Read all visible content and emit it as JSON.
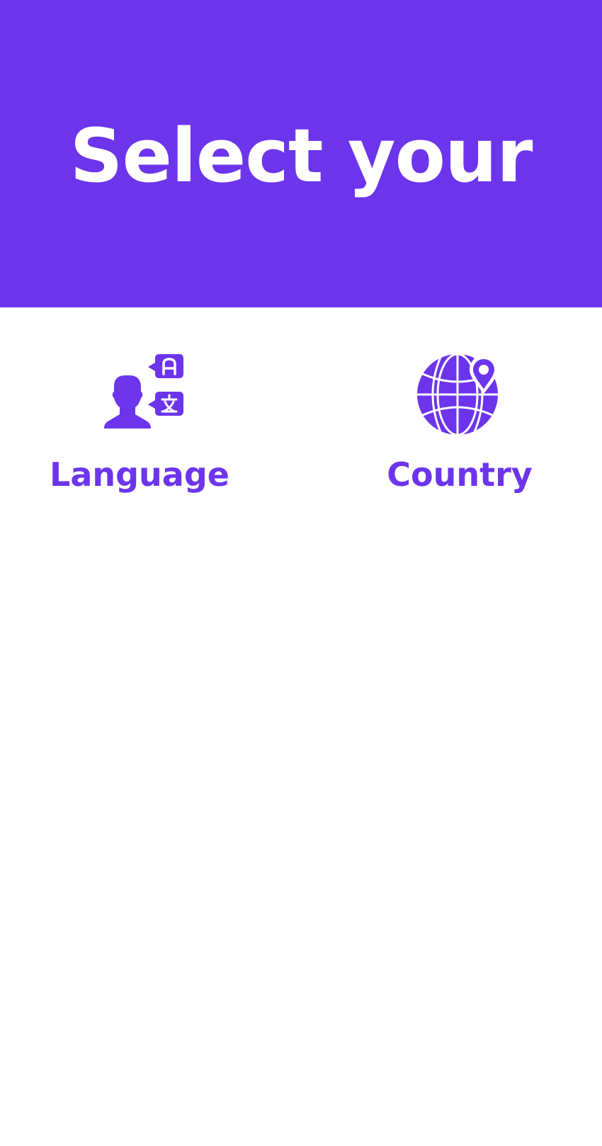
{
  "header": {
    "title": "Select your"
  },
  "options": [
    {
      "label": "Language",
      "icon": "language-translate-icon"
    },
    {
      "label": "Country",
      "icon": "globe-location-icon"
    }
  ],
  "colors": {
    "accent": "#6C35EC",
    "background": "#FFFFFF",
    "header_text": "#FFFFFF"
  }
}
